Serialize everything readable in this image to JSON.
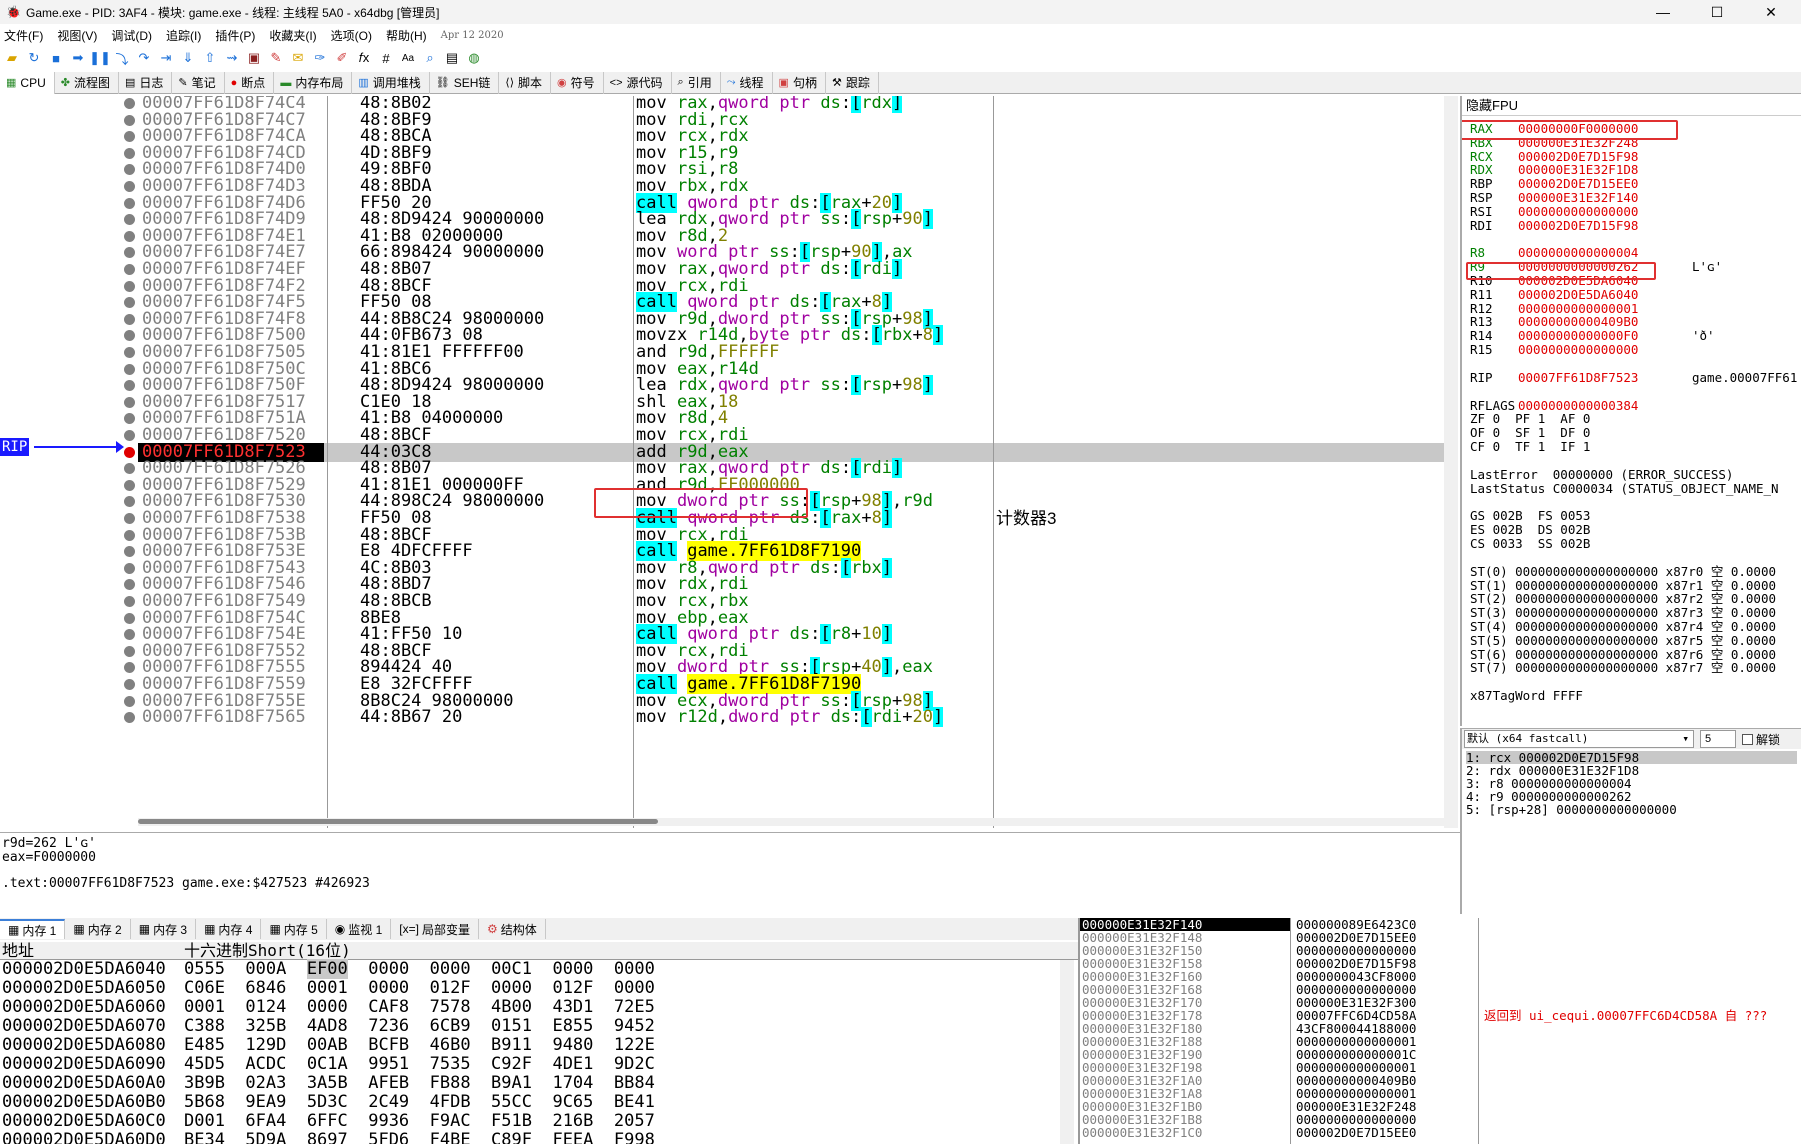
{
  "window": {
    "title": "Game.exe - PID: 3AF4 - 模块: game.exe - 线程: 主线程 5A0 - x64dbg [管理员]",
    "minimize": "—",
    "maximize": "☐",
    "close": "✕"
  },
  "menu": {
    "items": [
      "文件(F)",
      "视图(V)",
      "调试(D)",
      "追踪(I)",
      "插件(P)",
      "收藏夹(I)",
      "选项(O)",
      "帮助(H)"
    ],
    "date": "Apr 12 2020"
  },
  "tabs": [
    {
      "label": "CPU",
      "icon": "cpu-icon"
    },
    {
      "label": "流程图",
      "icon": "graph-icon"
    },
    {
      "label": "日志",
      "icon": "log-icon"
    },
    {
      "label": "笔记",
      "icon": "notes-icon"
    },
    {
      "label": "断点",
      "icon": "breakpoint-icon"
    },
    {
      "label": "内存布局",
      "icon": "memory-map-icon"
    },
    {
      "label": "调用堆栈",
      "icon": "callstack-icon"
    },
    {
      "label": "SEH链",
      "icon": "seh-icon"
    },
    {
      "label": "脚本",
      "icon": "script-icon"
    },
    {
      "label": "符号",
      "icon": "symbols-icon"
    },
    {
      "label": "源代码",
      "icon": "source-icon"
    },
    {
      "label": "引用",
      "icon": "references-icon"
    },
    {
      "label": "线程",
      "icon": "threads-icon"
    },
    {
      "label": "句柄",
      "icon": "handles-icon"
    },
    {
      "label": "跟踪",
      "icon": "trace-icon"
    }
  ],
  "disasm": {
    "rip_label": "RIP",
    "rows": [
      {
        "addr": "00007FF61D8F74C4",
        "bytes": "48:8B02",
        "ins": "mov rax,qword ptr ds:[rdx]"
      },
      {
        "addr": "00007FF61D8F74C7",
        "bytes": "48:8BF9",
        "ins": "mov rdi,rcx"
      },
      {
        "addr": "00007FF61D8F74CA",
        "bytes": "48:8BCA",
        "ins": "mov rcx,rdx"
      },
      {
        "addr": "00007FF61D8F74CD",
        "bytes": "4D:8BF9",
        "ins": "mov r15,r9"
      },
      {
        "addr": "00007FF61D8F74D0",
        "bytes": "49:8BF0",
        "ins": "mov rsi,r8"
      },
      {
        "addr": "00007FF61D8F74D3",
        "bytes": "48:8BDA",
        "ins": "mov rbx,rdx"
      },
      {
        "addr": "00007FF61D8F74D6",
        "bytes": "FF50 20",
        "ins": "call qword ptr ds:[rax+20]"
      },
      {
        "addr": "00007FF61D8F74D9",
        "bytes": "48:8D9424 90000000",
        "ins": "lea rdx,qword ptr ss:[rsp+90]"
      },
      {
        "addr": "00007FF61D8F74E1",
        "bytes": "41:B8 02000000",
        "ins": "mov r8d,2"
      },
      {
        "addr": "00007FF61D8F74E7",
        "bytes": "66:898424 90000000",
        "ins": "mov word ptr ss:[rsp+90],ax"
      },
      {
        "addr": "00007FF61D8F74EF",
        "bytes": "48:8B07",
        "ins": "mov rax,qword ptr ds:[rdi]"
      },
      {
        "addr": "00007FF61D8F74F2",
        "bytes": "48:8BCF",
        "ins": "mov rcx,rdi"
      },
      {
        "addr": "00007FF61D8F74F5",
        "bytes": "FF50 08",
        "ins": "call qword ptr ds:[rax+8]"
      },
      {
        "addr": "00007FF61D8F74F8",
        "bytes": "44:8B8C24 98000000",
        "ins": "mov r9d,dword ptr ss:[rsp+98]"
      },
      {
        "addr": "00007FF61D8F7500",
        "bytes": "44:0FB673 08",
        "ins": "movzx r14d,byte ptr ds:[rbx+8]"
      },
      {
        "addr": "00007FF61D8F7505",
        "bytes": "41:81E1 FFFFFF00",
        "ins": "and r9d,FFFFFF"
      },
      {
        "addr": "00007FF61D8F750C",
        "bytes": "41:8BC6",
        "ins": "mov eax,r14d"
      },
      {
        "addr": "00007FF61D8F750F",
        "bytes": "48:8D9424 98000000",
        "ins": "lea rdx,qword ptr ss:[rsp+98]"
      },
      {
        "addr": "00007FF61D8F7517",
        "bytes": "C1E0 18",
        "ins": "shl eax,18"
      },
      {
        "addr": "00007FF61D8F751A",
        "bytes": "41:B8 04000000",
        "ins": "mov r8d,4"
      },
      {
        "addr": "00007FF61D8F7520",
        "bytes": "48:8BCF",
        "ins": "mov rcx,rdi"
      },
      {
        "addr": "00007FF61D8F7523",
        "bytes": "44:03C8",
        "ins": "add r9d,eax"
      },
      {
        "addr": "00007FF61D8F7526",
        "bytes": "48:8B07",
        "ins": "mov rax,qword ptr ds:[rdi]"
      },
      {
        "addr": "00007FF61D8F7529",
        "bytes": "41:81E1 000000FF",
        "ins": "and r9d,FF000000"
      },
      {
        "addr": "00007FF61D8F7530",
        "bytes": "44:898C24 98000000",
        "ins": "mov dword ptr ss:[rsp+98],r9d"
      },
      {
        "addr": "00007FF61D8F7538",
        "bytes": "FF50 08",
        "ins": "call qword ptr ds:[rax+8]",
        "comment": "计数器3"
      },
      {
        "addr": "00007FF61D8F753B",
        "bytes": "48:8BCF",
        "ins": "mov rcx,rdi"
      },
      {
        "addr": "00007FF61D8F753E",
        "bytes": "E8 4DFCFFFF",
        "ins": "call game.7FF61D8F7190"
      },
      {
        "addr": "00007FF61D8F7543",
        "bytes": "4C:8B03",
        "ins": "mov r8,qword ptr ds:[rbx]"
      },
      {
        "addr": "00007FF61D8F7546",
        "bytes": "48:8BD7",
        "ins": "mov rdx,rdi"
      },
      {
        "addr": "00007FF61D8F7549",
        "bytes": "48:8BCB",
        "ins": "mov rcx,rbx"
      },
      {
        "addr": "00007FF61D8F754C",
        "bytes": "8BE8",
        "ins": "mov ebp,eax"
      },
      {
        "addr": "00007FF61D8F754E",
        "bytes": "41:FF50 10",
        "ins": "call qword ptr ds:[r8+10]"
      },
      {
        "addr": "00007FF61D8F7552",
        "bytes": "48:8BCF",
        "ins": "mov rcx,rdi"
      },
      {
        "addr": "00007FF61D8F7555",
        "bytes": "894424 40",
        "ins": "mov dword ptr ss:[rsp+40],eax"
      },
      {
        "addr": "00007FF61D8F7559",
        "bytes": "E8 32FCFFFF",
        "ins": "call game.7FF61D8F7190"
      },
      {
        "addr": "00007FF61D8F755E",
        "bytes": "8B8C24 98000000",
        "ins": "mov ecx,dword ptr ss:[rsp+98]"
      },
      {
        "addr": "00007FF61D8F7565",
        "bytes": "44:8B67 20",
        "ins": "mov r12d,dword ptr ds:[rdi+20]"
      }
    ]
  },
  "info": {
    "line1": "r9d=262 L'ɢ'",
    "line2": "eax=F0000000",
    "line3": ".text:00007FF61D8F7523 game.exe:$427523 #426923"
  },
  "registers": {
    "header": "隐藏FPU",
    "gpr": [
      {
        "name": "RAX",
        "value": "00000000F0000000"
      },
      {
        "name": "RBX",
        "value": "000000E31E32F248"
      },
      {
        "name": "RCX",
        "value": "000002D0E7D15F98"
      },
      {
        "name": "RDX",
        "value": "000000E31E32F1D8"
      },
      {
        "name": "RBP",
        "value": "000002D0E7D15EE0"
      },
      {
        "name": "RSP",
        "value": "000000E31E32F140"
      },
      {
        "name": "RSI",
        "value": "0000000000000000"
      },
      {
        "name": "RDI",
        "value": "000002D0E7D15F98"
      }
    ],
    "ext": [
      {
        "name": "R8",
        "value": "0000000000000004",
        "comment": ""
      },
      {
        "name": "R9",
        "value": "0000000000000262",
        "comment": "L'ɢ'"
      },
      {
        "name": "R10",
        "value": "000002D0E5DA6040",
        "comment": ""
      },
      {
        "name": "R11",
        "value": "000002D0E5DA6040",
        "comment": ""
      },
      {
        "name": "R12",
        "value": "0000000000000001",
        "comment": ""
      },
      {
        "name": "R13",
        "value": "00000000000409B0",
        "comment": ""
      },
      {
        "name": "R14",
        "value": "00000000000000F0",
        "comment": "'ð'"
      },
      {
        "name": "R15",
        "value": "0000000000000000",
        "comment": ""
      }
    ],
    "rip": {
      "name": "RIP",
      "value": "00007FF61D8F7523",
      "comment": "game.00007FF61"
    },
    "rflags": {
      "name": "RFLAGS",
      "value": "0000000000000384"
    },
    "flags_line1": "ZF 0  PF 1  AF 0",
    "flags_line2": "OF 0  SF 1  DF 0",
    "flags_line3": "CF 0  TF 1  IF 1",
    "last_error": "LastError  00000000 (ERROR_SUCCESS)",
    "last_status": "LastStatus C0000034 (STATUS_OBJECT_NAME_N",
    "seg1": "GS 002B  FS 0053",
    "seg2": "ES 002B  DS 002B",
    "seg3": "CS 0033  SS 002B",
    "fpu": [
      "ST(0) 0000000000000000000 x87r0 空 0.0000",
      "ST(1) 0000000000000000000 x87r1 空 0.0000",
      "ST(2) 0000000000000000000 x87r2 空 0.0000",
      "ST(3) 0000000000000000000 x87r3 空 0.0000",
      "ST(4) 0000000000000000000 x87r4 空 0.0000",
      "ST(5) 0000000000000000000 x87r5 空 0.0000",
      "ST(6) 0000000000000000000 x87r6 空 0.0000",
      "ST(7) 0000000000000000000 x87r7 空 0.0000"
    ],
    "tagword": "x87TagWord FFFF"
  },
  "callconv": {
    "selected": "默认 (x64 fastcall)",
    "count": "5",
    "unlock_label": "解锁",
    "args": [
      "1: rcx 000002D0E7D15F98",
      "2: rdx 000000E31E32F1D8",
      "3: r8 0000000000000004",
      "4: r9 0000000000000262",
      "5: [rsp+28] 0000000000000000"
    ]
  },
  "bottom_tabs": [
    {
      "label": "内存 1",
      "icon": "memory-icon"
    },
    {
      "label": "内存 2",
      "icon": "memory-icon"
    },
    {
      "label": "内存 3",
      "icon": "memory-icon"
    },
    {
      "label": "内存 4",
      "icon": "memory-icon"
    },
    {
      "label": "内存 5",
      "icon": "memory-icon"
    },
    {
      "label": "监视 1",
      "icon": "watch-icon"
    },
    {
      "label": "局部变量",
      "icon": "locals-icon"
    },
    {
      "label": "结构体",
      "icon": "struct-icon"
    }
  ],
  "dump": {
    "col_addr": "地址",
    "col_hex": "十六进制Short(16位)",
    "rows": [
      {
        "addr": "000002D0E5DA6040",
        "hex": "0555  000A  EF00  0000  0000  00C1  0000  0000"
      },
      {
        "addr": "000002D0E5DA6050",
        "hex": "C06E  6846  0001  0000  012F  0000  012F  0000"
      },
      {
        "addr": "000002D0E5DA6060",
        "hex": "0001  0124  0000  CAF8  7578  4B00  43D1  72E5"
      },
      {
        "addr": "000002D0E5DA6070",
        "hex": "C388  325B  4AD8  7236  6CB9  0151  E855  9452"
      },
      {
        "addr": "000002D0E5DA6080",
        "hex": "E485  129D  00AB  BCFB  46B0  B911  9480  122E"
      },
      {
        "addr": "000002D0E5DA6090",
        "hex": "45D5  ACDC  0C1A  9951  7535  C92F  4DE1  9D2C"
      },
      {
        "addr": "000002D0E5DA60A0",
        "hex": "3B9B  02A3  3A5B  AFEB  FB88  B9A1  1704  BB84"
      },
      {
        "addr": "000002D0E5DA60B0",
        "hex": "5B68  9EA9  5D3C  2C49  4FDB  55CC  9C65  BE41"
      },
      {
        "addr": "000002D0E5DA60C0",
        "hex": "D001  6FA4  6FFC  9936  F9AC  F51B  216B  2057"
      },
      {
        "addr": "000002D0E5DA60D0",
        "hex": "BE34  5D9A  8697  5FD6  F4BE  C89F  FEEA  F998"
      }
    ]
  },
  "stack": {
    "rows": [
      {
        "addr": "000000E31E32F140",
        "val": "000000089E6423C0",
        "cmt": ""
      },
      {
        "addr": "000000E31E32F148",
        "val": "000002D0E7D15EE0",
        "cmt": ""
      },
      {
        "addr": "000000E31E32F150",
        "val": "0000000000000000",
        "cmt": ""
      },
      {
        "addr": "000000E31E32F158",
        "val": "000002D0E7D15F98",
        "cmt": ""
      },
      {
        "addr": "000000E31E32F160",
        "val": "0000000043CF8000",
        "cmt": ""
      },
      {
        "addr": "000000E31E32F168",
        "val": "0000000000000000",
        "cmt": ""
      },
      {
        "addr": "000000E31E32F170",
        "val": "000000E31E32F300",
        "cmt": ""
      },
      {
        "addr": "000000E31E32F178",
        "val": "00007FFC6D4CD58A",
        "cmt": "返回到 ui_cequi.00007FFC6D4CD58A 自 ???"
      },
      {
        "addr": "000000E31E32F180",
        "val": "43CF800044188000",
        "cmt": ""
      },
      {
        "addr": "000000E31E32F188",
        "val": "0000000000000001",
        "cmt": ""
      },
      {
        "addr": "000000E31E32F190",
        "val": "000000000000001C",
        "cmt": ""
      },
      {
        "addr": "000000E31E32F198",
        "val": "0000000000000001",
        "cmt": ""
      },
      {
        "addr": "000000E31E32F1A0",
        "val": "00000000000409B0",
        "cmt": ""
      },
      {
        "addr": "000000E31E32F1A8",
        "val": "0000000000000001",
        "cmt": ""
      },
      {
        "addr": "000000E31E32F1B0",
        "val": "000000E31E32F248",
        "cmt": ""
      },
      {
        "addr": "000000E31E32F1B8",
        "val": "0000000000000000",
        "cmt": ""
      },
      {
        "addr": "000000E31E32F1C0",
        "val": "000002D0E7D15EE0",
        "cmt": ""
      }
    ]
  },
  "colors": {
    "accent": "#1a1aff",
    "register_value": "#e00000",
    "call_highlight": "#00ffff",
    "call_target_highlight": "#ffff00",
    "current_line": "#c8c8c8"
  }
}
